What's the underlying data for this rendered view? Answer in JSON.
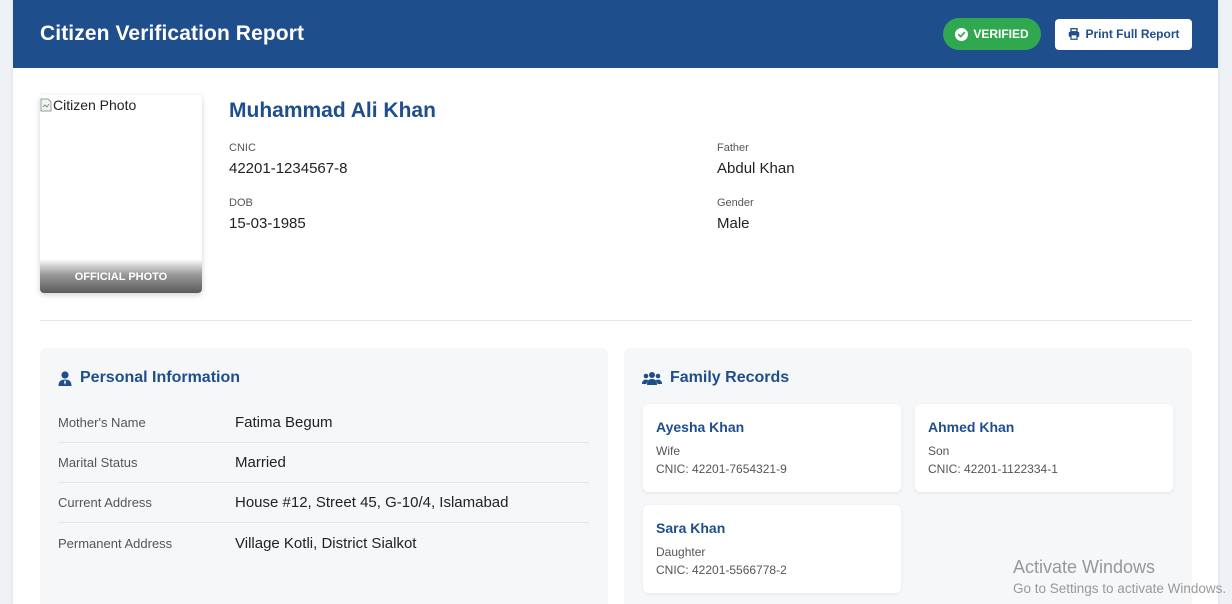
{
  "header": {
    "title": "Citizen Verification Report",
    "verified_label": "VERIFIED",
    "print_label": "Print Full Report",
    "colors": {
      "bar": "#1f4e8c",
      "verified": "#2fa84f"
    }
  },
  "profile": {
    "photo_alt": "Citizen Photo",
    "photo_caption": "OFFICIAL PHOTO",
    "name": "Muhammad Ali Khan",
    "fields": [
      {
        "label": "CNIC",
        "value": "42201-1234567-8"
      },
      {
        "label": "Father",
        "value": "Abdul Khan"
      },
      {
        "label": "DOB",
        "value": "15-03-1985"
      },
      {
        "label": "Gender",
        "value": "Male"
      }
    ]
  },
  "personal": {
    "title": "Personal Information",
    "icon": "user-icon",
    "rows": [
      {
        "label": "Mother's Name",
        "value": "Fatima Begum"
      },
      {
        "label": "Marital Status",
        "value": "Married"
      },
      {
        "label": "Current Address",
        "value": "House #12, Street 45, G-10/4, Islamabad"
      },
      {
        "label": "Permanent Address",
        "value": "Village Kotli, District Sialkot"
      }
    ]
  },
  "family": {
    "title": "Family Records",
    "icon": "users-icon",
    "members": [
      {
        "name": "Ayesha Khan",
        "relation": "Wife",
        "cnic": "CNIC: 42201-7654321-9"
      },
      {
        "name": "Ahmed Khan",
        "relation": "Son",
        "cnic": "CNIC: 42201-1122334-1"
      },
      {
        "name": "Sara Khan",
        "relation": "Daughter",
        "cnic": "CNIC: 42201-5566778-2"
      }
    ]
  },
  "overlay": {
    "title": "Activate Windows",
    "subtitle": "Go to Settings to activate Windows."
  }
}
